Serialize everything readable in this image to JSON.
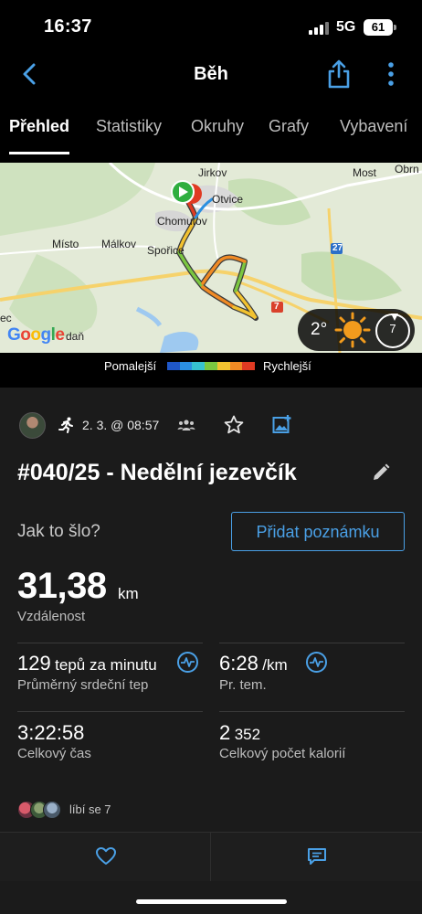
{
  "status": {
    "time": "16:37",
    "network": "5G",
    "battery": "61"
  },
  "nav": {
    "title": "Běh"
  },
  "tabs": [
    {
      "label": "Přehled",
      "active": true
    },
    {
      "label": "Statistiky"
    },
    {
      "label": "Okruhy"
    },
    {
      "label": "Grafy"
    },
    {
      "label": "Vybavení"
    }
  ],
  "map": {
    "places": [
      "Jirkov",
      "Otvice",
      "Chomutov",
      "Most",
      "Obrn",
      "Místo",
      "Málkov",
      "Spořice",
      "ec",
      "daň"
    ],
    "road_badges": [
      "27",
      "7"
    ],
    "attribution": "Google",
    "weather": {
      "temperature": "2°",
      "icon": "sun-icon",
      "wind": "7"
    }
  },
  "legend": {
    "slow": "Pomalejší",
    "fast": "Rychlejší",
    "colors": [
      "#1f57c8",
      "#2b8fe0",
      "#36c1d0",
      "#7bc640",
      "#f2c230",
      "#f08a24",
      "#e03a22"
    ]
  },
  "activity": {
    "date": "2. 3. @ 08:57",
    "title": "#040/25 - Nedělní jezevčík",
    "prompt": "Jak to šlo?",
    "add_note": "Přidat poznámku"
  },
  "distance": {
    "value": "31,38",
    "unit": "km",
    "label": "Vzdálenost"
  },
  "stats": {
    "hr": {
      "value": "129",
      "unit": "tepů za minutu",
      "label": "Průměrný srdeční tep"
    },
    "pace": {
      "value": "6:28",
      "unit": "/km",
      "label": "Pr. tem."
    },
    "time": {
      "value": "3:22:58",
      "label": "Celkový čas"
    },
    "calories": {
      "value": "2",
      "value_small": "352",
      "label": "Celkový počet kalorií"
    }
  },
  "likes": {
    "text": "líbí se 7"
  },
  "colors": {
    "accent": "#4aa0e6",
    "background": "#1b1b1b"
  }
}
